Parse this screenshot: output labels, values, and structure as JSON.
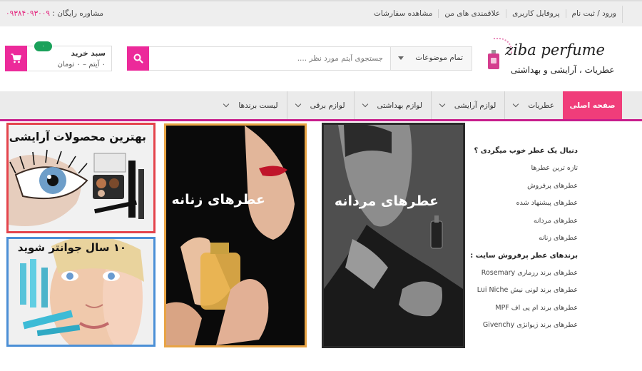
{
  "topbar": {
    "phone_label": "مشاوره رایگان :",
    "phone_number": "۰۹۳۸۴۰۹۳۰۰۹",
    "links": [
      {
        "label": "ورود / ثبت نام"
      },
      {
        "label": "پروفایل کاربری"
      },
      {
        "label": "علاقمندی های من"
      },
      {
        "label": "مشاهده سفارشات"
      }
    ]
  },
  "logo": {
    "brand": "ziba perfume",
    "tagline": "عطریات ، آرایشی و بهداشتی"
  },
  "search": {
    "category_label": "تمام موضوعات",
    "placeholder": "جستجوی آیتم مورد نظر ....",
    "value": ""
  },
  "cart": {
    "title": "سبد خرید",
    "summary": "۰ آیتم – ۰ تومان",
    "badge": "۰"
  },
  "nav": {
    "home": "صفحه اصلی",
    "items": [
      {
        "label": "عطریات"
      },
      {
        "label": "لوازم آرایشی"
      },
      {
        "label": "لوازم بهداشتی"
      },
      {
        "label": "لوازم برقی"
      },
      {
        "label": "لیست برندها"
      }
    ]
  },
  "banners": {
    "eye": "بهترین محصولات آرایشی چشم",
    "young": "۱۰ سال جوانتر شوید",
    "women": "عطرهای زنانه",
    "men": "عطرهای مردانه"
  },
  "sidebar": {
    "heading1": "دنبال یک عطر خوب میگردی ؟",
    "group1": [
      {
        "label": "تازه ترین عطرها"
      },
      {
        "label": "عطرهای پرفروش"
      },
      {
        "label": "عطرهای پیشنهاد شده"
      },
      {
        "label": "عطرهای مردانه"
      },
      {
        "label": "عطرهای زنانه"
      }
    ],
    "heading2": "برندهای عطر پرفروش سایت :",
    "group2": [
      {
        "label": "عطرهای برند رزماری Rosemary"
      },
      {
        "label": "عطرهای برند لونی نیش Lui Niche"
      },
      {
        "label": "عطرهای برند ام پی اف MPF"
      },
      {
        "label": "عطرهای برند ژیوانژی Givenchy"
      }
    ]
  },
  "colors": {
    "accent": "#ec2a9a",
    "home_tab": "#f03d7a",
    "nav_border": "#c81e8c",
    "badge": "#1aa15a"
  }
}
